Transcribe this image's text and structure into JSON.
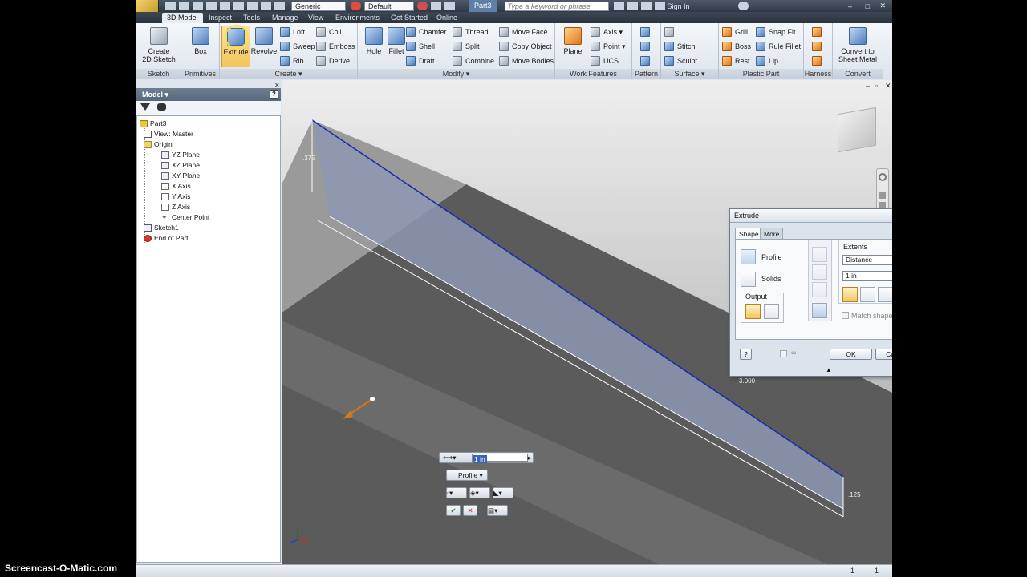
{
  "quick_access": {
    "appearance_value": "Generic",
    "material_value": "Default",
    "document_tab": "Part3",
    "search_placeholder": "Type a keyword or phrase",
    "sign_in": "Sign In"
  },
  "tabs": [
    "3D Model",
    "Inspect",
    "Tools",
    "Manage",
    "View",
    "Environments",
    "Get Started",
    "Online"
  ],
  "ribbon": {
    "sketch": {
      "title": "Sketch",
      "create_2d_sketch": "Create\n2D Sketch"
    },
    "primitives": {
      "title": "Primitives",
      "box": "Box"
    },
    "create": {
      "title": "Create",
      "extrude": "Extrude",
      "revolve": "Revolve",
      "loft": "Loft",
      "sweep": "Sweep",
      "rib": "Rib",
      "coil": "Coil",
      "emboss": "Emboss",
      "derive": "Derive"
    },
    "modify": {
      "title": "Modify",
      "hole": "Hole",
      "fillet": "Fillet",
      "chamfer": "Chamfer",
      "shell": "Shell",
      "draft": "Draft",
      "thread": "Thread",
      "split": "Split",
      "combine": "Combine",
      "move_face": "Move Face",
      "copy_object": "Copy Object",
      "move_bodies": "Move Bodies"
    },
    "work_features": {
      "title": "Work Features",
      "plane": "Plane",
      "axis": "Axis",
      "point": "Point",
      "ucs": "UCS"
    },
    "pattern": {
      "title": "Pattern"
    },
    "surface": {
      "title": "Surface",
      "stitch": "Stitch",
      "sculpt": "Sculpt"
    },
    "plastic_part": {
      "title": "Plastic Part",
      "grill": "Grill",
      "boss": "Boss",
      "rest": "Rest",
      "snap_fit": "Snap Fit",
      "rule_fillet": "Rule Fillet",
      "lip": "Lip"
    },
    "harness": {
      "title": "Harness"
    },
    "convert": {
      "title": "Convert",
      "convert_to_sheet_metal": "Convert to\nSheet Metal"
    }
  },
  "browser": {
    "title": "Model",
    "help": "?",
    "items": [
      {
        "label": "Part3"
      },
      {
        "label": "View: Master"
      },
      {
        "label": "Origin"
      },
      {
        "label": "YZ Plane"
      },
      {
        "label": "XZ Plane"
      },
      {
        "label": "XY Plane"
      },
      {
        "label": "X Axis"
      },
      {
        "label": "Y Axis"
      },
      {
        "label": "Z Axis"
      },
      {
        "label": "Center Point"
      },
      {
        "label": "Sketch1"
      },
      {
        "label": "End of Part"
      }
    ]
  },
  "viewport": {
    "dim_length": "3.000",
    "dim_height": ".125",
    "dim_left": ".375"
  },
  "mini_toolbar": {
    "distance_value": "1 in",
    "profile_label": "Profile"
  },
  "extrude_dialog": {
    "title": "Extrude",
    "tab_shape": "Shape",
    "tab_more": "More",
    "profile_label": "Profile",
    "solids_label": "Solids",
    "output_label": "Output",
    "extents_label": "Extents",
    "extents_value": "Distance",
    "distance_value": "1 in",
    "match_shape": "Match shape",
    "ok": "OK",
    "cancel": "Cancel"
  },
  "statusbar": {
    "left_count": "1",
    "right_count": "1"
  },
  "watermark": "Screencast-O-Matic.com"
}
